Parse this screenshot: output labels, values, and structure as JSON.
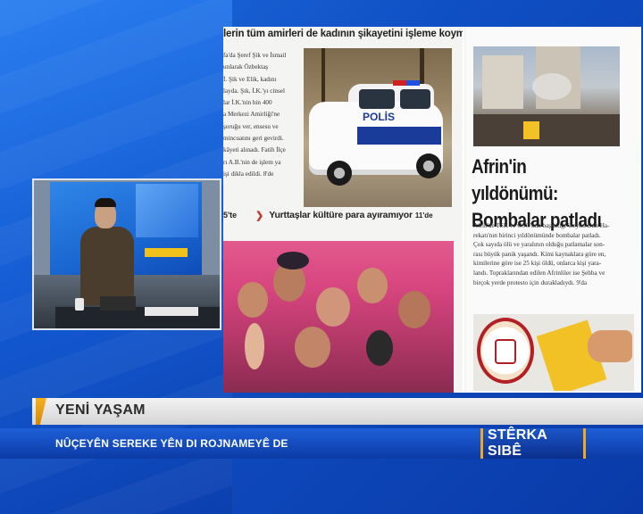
{
  "newspaper": {
    "top_headline": "lerin tüm amirleri de kadının şikayetini işleme koymadı",
    "story_text_lines": [
      "fa'da Şeref Şik ve İsmail",
      "unlarak Özbektaş",
      "İ. Şik ve Elik, kadını",
      "layda. Şık, İ.K.'yı cinsel",
      "lar İ.K.'nin bin 400",
      "a Merkezi Amirliği'ne",
      "şoruğu ver, ensesu ve",
      "mincuatını geri gevirdi.",
      "kâyeti alınadı. Fatih İlçe",
      "rı A.B.'nin de işlem ya",
      "işi dikla edildi. 8'de"
    ],
    "police_text": "POLİS",
    "teaser_ref_left": "5'te",
    "teaser_title": "Yurttaşlar kültüre para ayıramıyor",
    "teaser_ref": "11'de",
    "main_headline_line1": "Afrin'in yıldönümü:",
    "main_headline_line2": "Bombalar patladı",
    "article_text_lines": [
      "Afrin'de TSK ve ÖSO'nun başlattığı 'Zeytin Dalı Ha-",
      "rekatı'nın birinci yıldönümünde bombalar patladı.",
      "Çok sayıda ölü ve yaralının olduğu patlamalar son-",
      "rası büyük panik yaşandı. Kimi kaynaklara göre en,",
      "kimilerine göre ise 25 kişi öldü, onlarca kişi yara-",
      "landı. Topraklarından edilen Afrinliler ise Şehba ve",
      "birçok yerde protesto için durakladıydı. 9'da"
    ]
  },
  "lower_third": {
    "channel": "YENİ YAŞAM",
    "ticker": "NÛÇEYÊN SEREKE YÊN DI ROJNAMEYÊ DE",
    "brand": "STÊRKA SIBÊ"
  },
  "colors": {
    "accent_orange": "#f3a81a",
    "brand_blue": "#0c3ba6",
    "bar_grey": "#d4d4d4"
  }
}
